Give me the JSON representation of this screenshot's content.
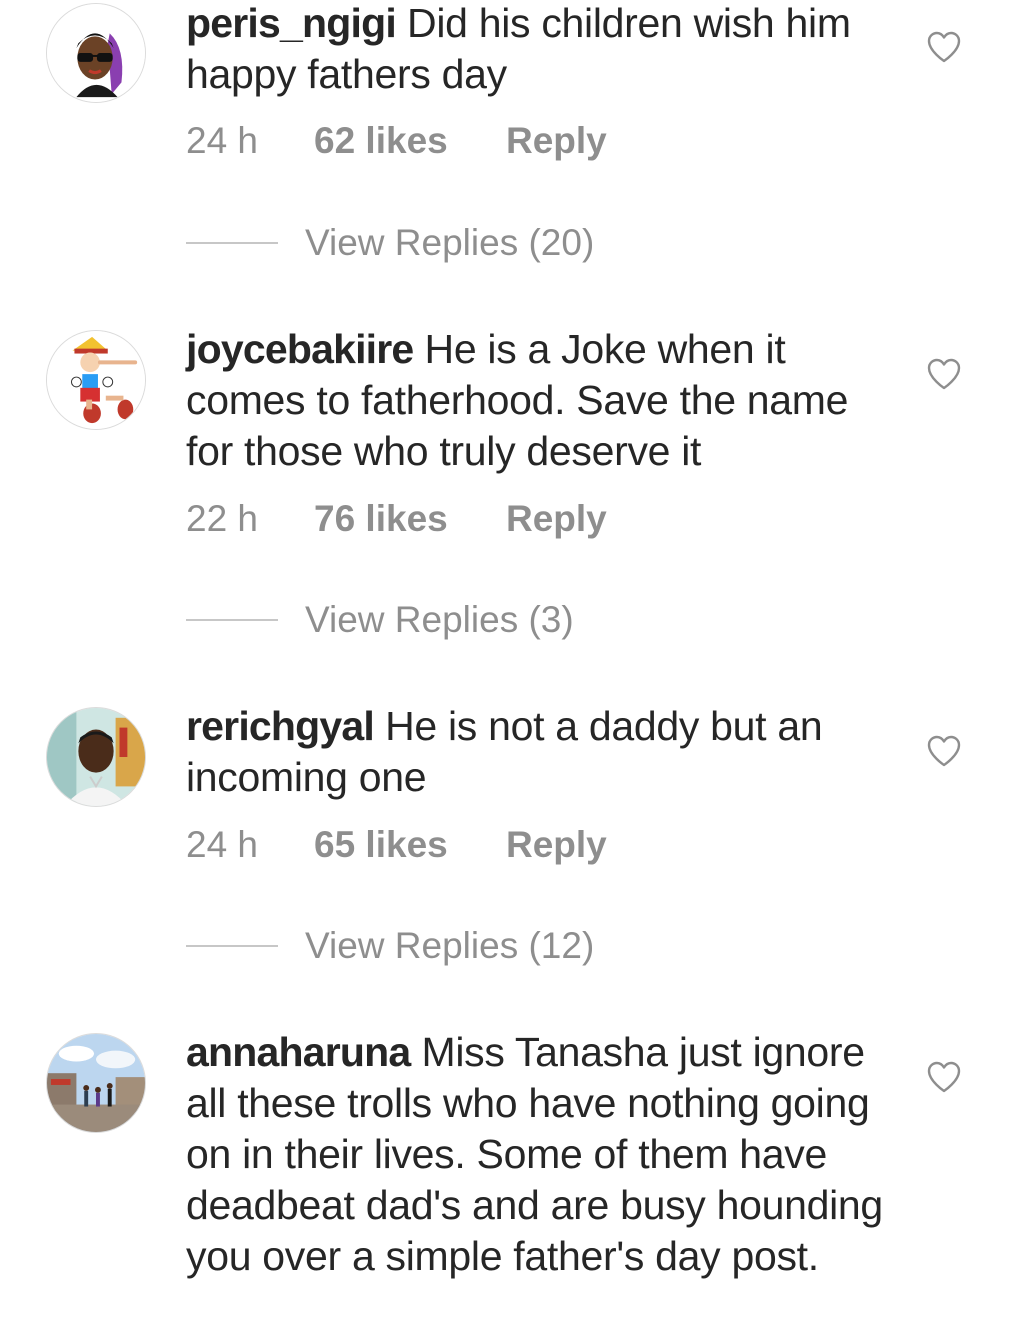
{
  "comments": [
    {
      "username": "peris_ngigi",
      "text": " Did his children wish him happy fathers  day",
      "time": "24 h",
      "likes": "62 likes",
      "reply_label": "Reply",
      "view_replies": "View Replies (20)",
      "avatar_icon": "bitmoji-avatar"
    },
    {
      "username": "joycebakiire",
      "text": " He is a Joke when it comes to fatherhood. Save the name for those who truly deserve it",
      "time": "22 h",
      "likes": "76 likes",
      "reply_label": "Reply",
      "view_replies": "View Replies (3)",
      "avatar_icon": "pinocchio-avatar"
    },
    {
      "username": "rerichgyal",
      "text": " He is not a daddy but an incoming one",
      "time": "24 h",
      "likes": "65 likes",
      "reply_label": "Reply",
      "view_replies": "View Replies (12)",
      "avatar_icon": "photo-avatar"
    },
    {
      "username": "annaharuna",
      "text": " Miss Tanasha just ignore all these trolls who have nothing going on in their lives. Some of them have deadbeat dad's and are busy hounding you over a simple father's day post.",
      "avatar_icon": "street-photo-avatar"
    }
  ],
  "colors": {
    "text": "#262626",
    "secondary": "#8e8e8e",
    "divider": "#c7c7c7",
    "heart_outline": "#8e8e8e"
  }
}
